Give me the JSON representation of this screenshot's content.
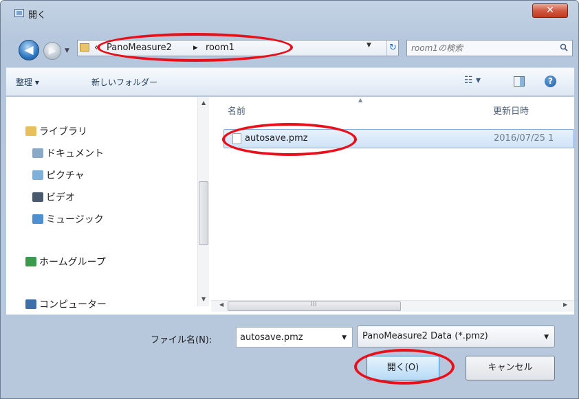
{
  "window": {
    "title": "開く",
    "close_glyph": "✕"
  },
  "nav": {
    "back_glyph": "◀",
    "forward_glyph": "▶",
    "breadcrumb_prefix": "«",
    "breadcrumb": [
      "PanoMeasure2",
      "room1"
    ],
    "separator": "▸",
    "search_placeholder": "room1の検索"
  },
  "toolbar": {
    "organize_label": "整理 ▾",
    "new_folder_label": "新しいフォルダー",
    "help_label": "?"
  },
  "sidebar": {
    "items": [
      {
        "label": "ライブラリ",
        "icon": "library-icon",
        "color": "#e6c05c"
      },
      {
        "label": "ドキュメント",
        "icon": "documents-icon",
        "color": "#8aa9c9"
      },
      {
        "label": "ピクチャ",
        "icon": "pictures-icon",
        "color": "#7fb0d9"
      },
      {
        "label": "ビデオ",
        "icon": "videos-icon",
        "color": "#4a5a6e"
      },
      {
        "label": "ミュージック",
        "icon": "music-icon",
        "color": "#4d8fd0"
      },
      {
        "label": "ホームグループ",
        "icon": "homegroup-icon",
        "color": "#3c9a4e"
      },
      {
        "label": "コンピューター",
        "icon": "computer-icon",
        "color": "#3f6ea8"
      }
    ]
  },
  "file_list": {
    "columns": [
      "名前",
      "更新日時"
    ],
    "rows": [
      {
        "name": "autosave.pmz",
        "modified": "2016/07/25 1"
      }
    ]
  },
  "bottom": {
    "filename_label": "ファイル名(N):",
    "filename_value": "autosave.pmz",
    "filter_value": "PanoMeasure2 Data (*.pmz)",
    "open_label": "開く(O)",
    "cancel_label": "キャンセル"
  },
  "colors": {
    "annotation": "#e8101a",
    "selection": "#cfe3f8",
    "frame": "#b7c8dc"
  }
}
